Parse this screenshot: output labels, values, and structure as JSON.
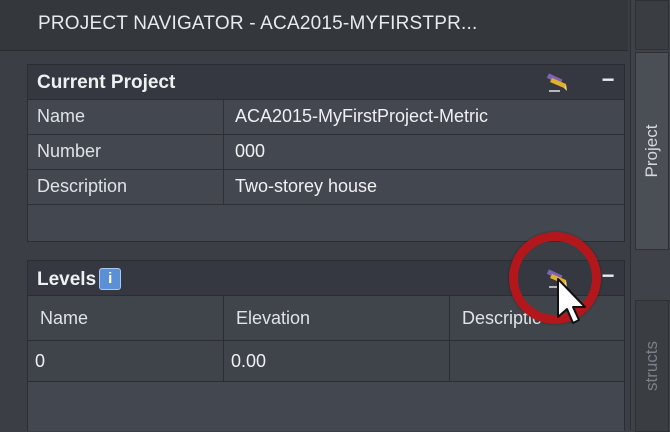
{
  "window": {
    "title": "PROJECT NAVIGATOR - ACA2015-MYFIRSTPR..."
  },
  "side_tabs": {
    "project": "Project",
    "constructs": "structs"
  },
  "current_project": {
    "header": "Current Project",
    "rows": [
      {
        "key": "Name",
        "value": "ACA2015-MyFirstProject-Metric"
      },
      {
        "key": "Number",
        "value": "000"
      },
      {
        "key": "Description",
        "value": "Two-storey house"
      }
    ]
  },
  "levels": {
    "header": "Levels",
    "info_badge": "i",
    "columns": [
      "Name",
      "Elevation",
      "Descriptio"
    ],
    "rows": [
      {
        "name": "0",
        "elevation": "0.00",
        "description": ""
      }
    ]
  },
  "icons": {
    "edit": "pencil-edit-icon",
    "collapse": "minus-collapse-icon",
    "info": "info-icon"
  },
  "colors": {
    "accent_highlight": "#b3171b",
    "info_badge": "#5b8fd6",
    "panel_bg": "#3b3e44"
  }
}
